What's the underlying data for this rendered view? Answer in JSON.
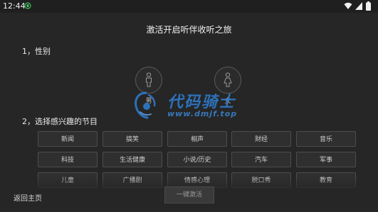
{
  "status_bar": {
    "time": "12:44",
    "icons": [
      "app-status-icon",
      "wifi-icon",
      "signal-icon",
      "battery-icon"
    ]
  },
  "header": {
    "title": "激活开启听伴收听之旅"
  },
  "gender_section": {
    "label": "1，性别",
    "options": [
      {
        "label": "男",
        "icon": "male-icon"
      },
      {
        "label": "女",
        "icon": "female-icon"
      }
    ]
  },
  "interest_section": {
    "label": "2，选择感兴趣的节目",
    "tags": [
      "新闻",
      "搞笑",
      "相声",
      "财经",
      "音乐",
      "科技",
      "生活健康",
      "小说/历史",
      "汽车",
      "军事",
      "儿童",
      "广播剧",
      "情感心理",
      "脱口秀",
      "教育"
    ]
  },
  "watermark": {
    "name": "代码骑士",
    "url": "www.dmjf.top",
    "color": "#2f7fd6"
  },
  "footer": {
    "back_label": "返回主页",
    "activate_label": "一键激活"
  }
}
